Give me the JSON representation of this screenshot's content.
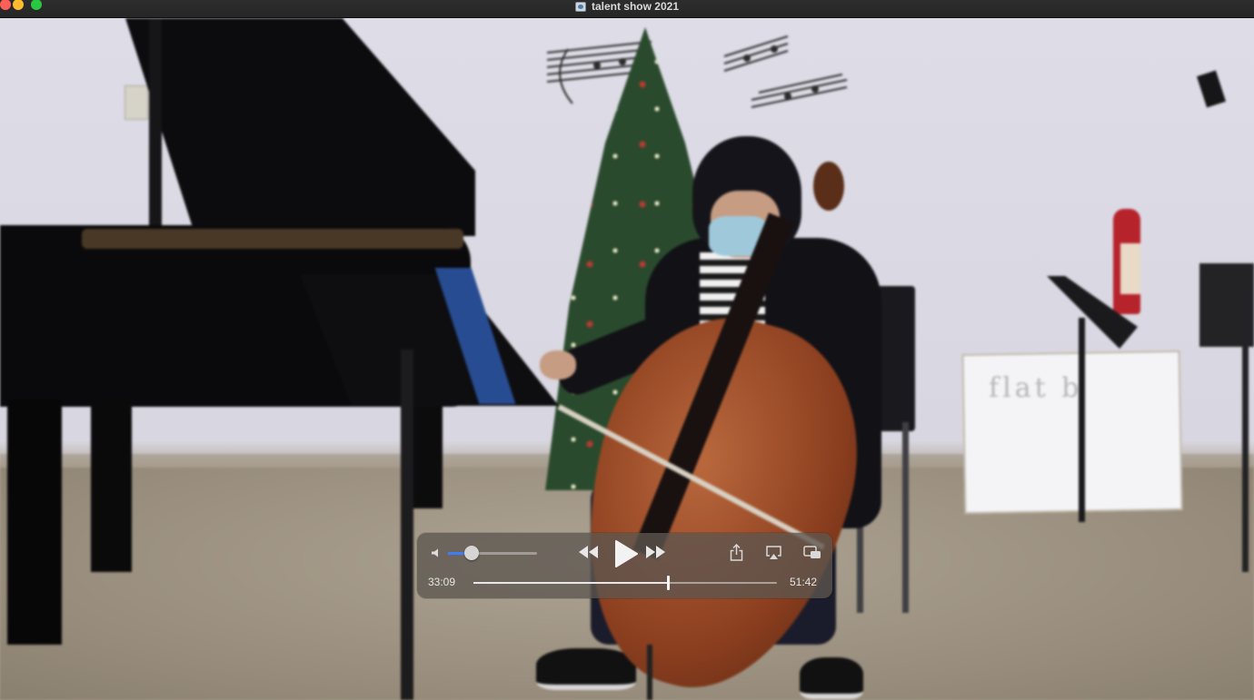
{
  "window": {
    "title": "talent show 2021",
    "icons": {
      "close": "close-icon",
      "minimize": "minimize-icon",
      "zoom": "zoom-icon",
      "document": "video-document-icon"
    },
    "colors": {
      "close": "#ff5f57",
      "minimize": "#febc2e",
      "zoom": "#28c840"
    }
  },
  "scene": {
    "whiteboard_text": "flat b"
  },
  "controls": {
    "volume": {
      "level": 0.27,
      "icon": "speaker-icon",
      "accent": "#3d7df6"
    },
    "rewind_icon": "rewind-icon",
    "play_icon": "play-icon",
    "fast_forward_icon": "fast-forward-icon",
    "share_icon": "share-icon",
    "airplay_icon": "airplay-icon",
    "pip_icon": "picture-in-picture-icon",
    "time": {
      "elapsed": "33:09",
      "total": "51:42",
      "progress": 0.641
    }
  }
}
